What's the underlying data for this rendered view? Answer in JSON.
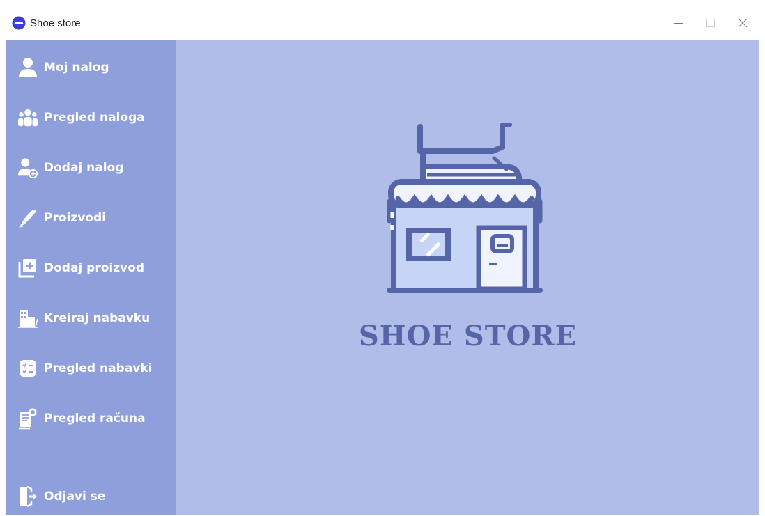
{
  "window": {
    "title": "Shoe store"
  },
  "sidebar": {
    "items": [
      {
        "label": "Moj nalog",
        "icon": "user-icon"
      },
      {
        "label": "Pregled naloga",
        "icon": "users-group-icon"
      },
      {
        "label": "Dodaj nalog",
        "icon": "add-user-icon"
      },
      {
        "label": "Proizvodi",
        "icon": "shoe-icon"
      },
      {
        "label": "Dodaj proizvod",
        "icon": "add-product-icon"
      },
      {
        "label": "Kreiraj nabavku",
        "icon": "warehouse-icon"
      },
      {
        "label": "Pregled nabavki",
        "icon": "checklist-icon"
      },
      {
        "label": "Pregled računa",
        "icon": "receipt-icon"
      },
      {
        "label": "Odjavi se",
        "icon": "logout-icon"
      }
    ]
  },
  "main": {
    "brand_title": "SHOE STORE",
    "logo_icon": "shoe-store-logo-icon"
  },
  "colors": {
    "sidebar_bg": "#8f9fdc",
    "content_bg": "#b0bde9",
    "brand_text": "#5565a8",
    "logo_outline": "#5565a8"
  }
}
